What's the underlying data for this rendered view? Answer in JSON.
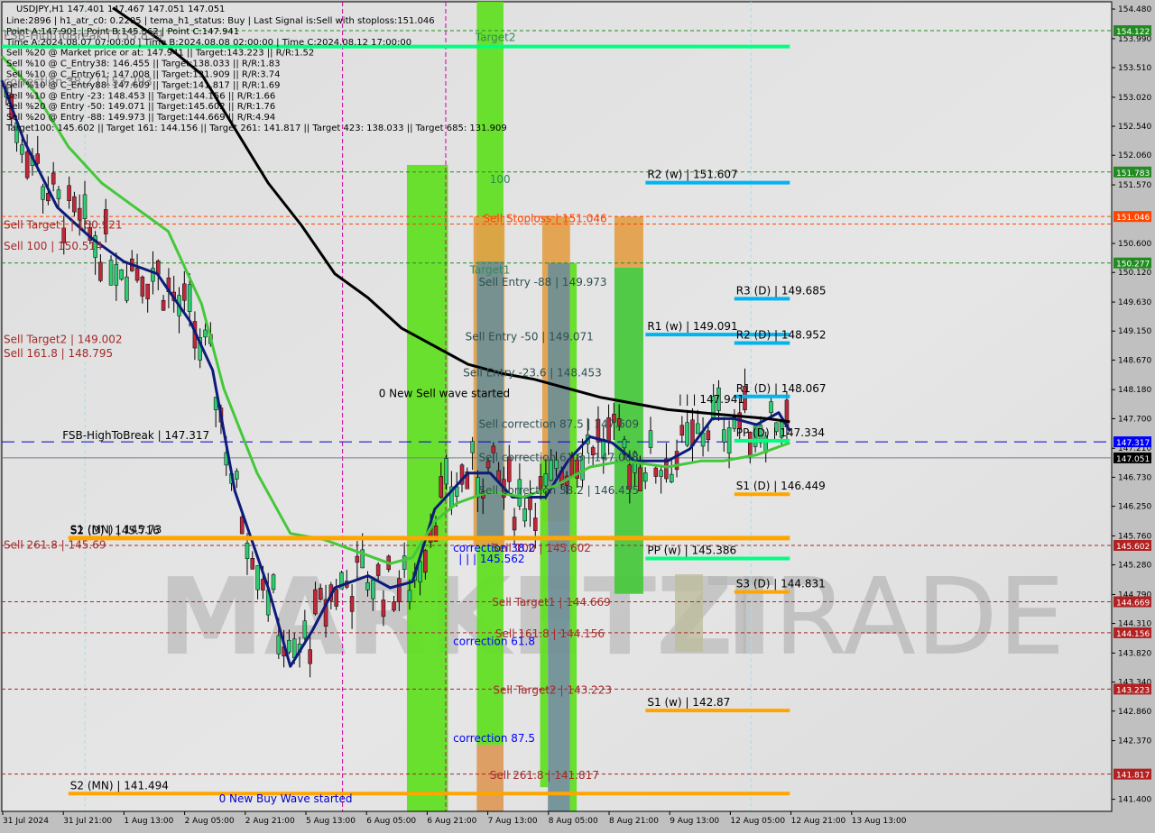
{
  "window": {
    "symbol_line": "USDJPY,H1  147.401 147.467 147.051 147.051"
  },
  "info_lines": [
    "Line:2896 | h1_atr_c0: 0.2205 | tema_h1_status: Buy | Last Signal is:Sell with stoploss:151.046",
    "Point A:147.901 | Point B:145.562 | Point C:147.941",
    "Time A:2024.08.07 07:00:00 | Time B:2024.08.08 02:00:00 | Time C:2024.08.12 17:00:00",
    "Sell %20 @ Market price or at: 147.941 || Target:143.223 || R/R:1.52",
    "Sell %10 @ C_Entry38: 146.455 || Target:138.033 || R/R:1.83",
    "Sell %10 @ C_Entry61: 147.008 || Target:131.909 || R/R:3.74",
    "Sell %10 @ C_Entry88: 147.609 || Target:141.817 || R/R:1.69",
    "Sell %10 @ Entry -23: 148.453 || Target:144.156 || R/R:1.66",
    "Sell %20 @ Entry -50: 149.071 || Target:145.602 || R/R:1.76",
    "Sell %20 @ Entry -88: 149.973 || Target:144.669 || R/R:4.94",
    "Target100: 145.602 || Target 161: 144.156 || Target 261: 141.817 || Target 423: 138.033 || Target 685: 131.909"
  ],
  "overlay_ghost_labels": [
    "FSB-HighToBreak | 153.839",
    "correction 38.2 | 153.293"
  ],
  "watermark": {
    "left": "MARKETZI",
    "right": "TRADE"
  },
  "colors": {
    "background": "#dcdcdc",
    "bull_candle": "#2ecc71",
    "bear_candle": "#c0283a",
    "ma_fast": "#0d1b7a",
    "ma_mid": "#44c83a",
    "ma_slow": "#000000",
    "green_zone": "#5ee01e",
    "orange_zone": "#e3a048",
    "grey_zone": "#6e8f96",
    "pivot_blue": "#00b4f0",
    "pivot_orange": "#ffa500",
    "pivot_green": "#00ff80",
    "sell_label": "#a52a2a",
    "stoploss_label": "#ff4500",
    "fsb_line": "#0000cc",
    "price_line": "#708090"
  },
  "chart_data": {
    "type": "candlestick",
    "title": "USDJPY,H1",
    "ohlc_last": {
      "open": 147.401,
      "high": 147.467,
      "low": 147.051,
      "close": 147.051
    },
    "ylim": [
      141.2,
      154.6
    ],
    "y_ticks": [
      "154.480",
      "153.990",
      "153.510",
      "153.020",
      "152.540",
      "152.060",
      "151.570",
      "150.600",
      "150.120",
      "149.630",
      "149.150",
      "148.670",
      "148.180",
      "147.700",
      "147.210",
      "146.730",
      "146.250",
      "145.760",
      "145.280",
      "144.790",
      "144.310",
      "143.820",
      "143.340",
      "142.860",
      "142.370",
      "141.400"
    ],
    "x_ticks": [
      "31 Jul 2024",
      "31 Jul 21:00",
      "1 Aug 13:00",
      "2 Aug 05:00",
      "2 Aug 21:00",
      "5 Aug 13:00",
      "6 Aug 05:00",
      "6 Aug 21:00",
      "7 Aug 13:00",
      "8 Aug 05:00",
      "8 Aug 21:00",
      "9 Aug 13:00",
      "12 Aug 05:00",
      "12 Aug 21:00",
      "13 Aug 13:00"
    ],
    "price_badges": [
      {
        "value": "154.122",
        "color": "#228b22"
      },
      {
        "value": "151.783",
        "color": "#228b22"
      },
      {
        "value": "151.046",
        "color": "#ff4500"
      },
      {
        "value": "150.277",
        "color": "#228b22"
      },
      {
        "value": "147.317",
        "color": "#0000ff"
      },
      {
        "value": "147.051",
        "color": "#000000"
      },
      {
        "value": "145.602",
        "color": "#b22222"
      },
      {
        "value": "144.669",
        "color": "#b22222"
      },
      {
        "value": "144.156",
        "color": "#b22222"
      },
      {
        "value": "143.223",
        "color": "#b22222"
      },
      {
        "value": "141.817",
        "color": "#b22222"
      }
    ],
    "hlines": [
      {
        "price": 154.122,
        "style": "dash",
        "color": "#228b22"
      },
      {
        "price": 151.783,
        "style": "dash",
        "color": "#228b22"
      },
      {
        "price": 151.046,
        "style": "dash",
        "color": "#ff4500"
      },
      {
        "price": 150.277,
        "style": "dash",
        "color": "#228b22"
      },
      {
        "price": 150.921,
        "style": "dash",
        "color": "#ff4500"
      },
      {
        "price": 147.317,
        "style": "longdash",
        "color": "#0000cc"
      },
      {
        "price": 147.051,
        "style": "solid",
        "color": "#708090"
      },
      {
        "price": 145.602,
        "style": "dash",
        "color": "#a52a2a"
      },
      {
        "price": 144.669,
        "style": "dash",
        "color": "#a52a2a"
      },
      {
        "price": 144.156,
        "style": "dash",
        "color": "#a52a2a"
      },
      {
        "price": 143.223,
        "style": "dash",
        "color": "#a52a2a"
      },
      {
        "price": 141.817,
        "style": "dash",
        "color": "#a52a2a"
      }
    ],
    "pivot_segments": [
      {
        "label": "R2 (w) | 151.607",
        "price": 151.607,
        "color": "#00b4f0",
        "x0": 0.58,
        "x1": 0.71
      },
      {
        "label": "R3 (D) | 149.685",
        "price": 149.685,
        "color": "#00b4f0",
        "x0": 0.66,
        "x1": 0.71
      },
      {
        "label": "R1 (w) | 149.091",
        "price": 149.091,
        "color": "#00b4f0",
        "x0": 0.58,
        "x1": 0.71
      },
      {
        "label": "R2 (D) | 148.952",
        "price": 148.952,
        "color": "#00b4f0",
        "x0": 0.66,
        "x1": 0.71
      },
      {
        "label": "R1 (D) | 148.067",
        "price": 148.067,
        "color": "#00b4f0",
        "x0": 0.66,
        "x1": 0.71
      },
      {
        "label": "PP (D) | 147.334",
        "price": 147.334,
        "color": "#00ff80",
        "x0": 0.66,
        "x1": 0.71
      },
      {
        "label": "S1 (D) | 146.449",
        "price": 146.449,
        "color": "#ffa500",
        "x0": 0.66,
        "x1": 0.71
      },
      {
        "label": "S2 (D) | 145.716",
        "price": 145.716,
        "color": "#ffa500",
        "x0": 0.06,
        "x1": 0.71
      },
      {
        "label": "PP (w) | 145.386",
        "price": 145.386,
        "color": "#00ff80",
        "x0": 0.58,
        "x1": 0.71
      },
      {
        "label": "S3 (D) | 144.831",
        "price": 144.831,
        "color": "#ffa500",
        "x0": 0.66,
        "x1": 0.71
      },
      {
        "label": "S1 (w) | 142.87",
        "price": 142.87,
        "color": "#ffa500",
        "x0": 0.58,
        "x1": 0.71
      },
      {
        "label": "S1 (MN) | 145.73",
        "price": 145.73,
        "color": "#ffa500",
        "x0": 0.06,
        "x1": 0.71
      },
      {
        "label": "S2 (MN) | 141.494",
        "price": 141.494,
        "color": "#ffa500",
        "x0": 0.06,
        "x1": 0.71
      },
      {
        "label": "",
        "price": 153.86,
        "color": "#00ff80",
        "x0": 0.0,
        "x1": 0.71
      }
    ],
    "text_labels": [
      {
        "text": "Target2",
        "price": 153.95,
        "x": 0.425,
        "color": "#2e8b57"
      },
      {
        "text": "100",
        "price": 151.6,
        "x": 0.438,
        "color": "#2e8b57"
      },
      {
        "text": "Sell Stoploss | 151.046",
        "price": 150.95,
        "x": 0.432,
        "color": "#ff4500"
      },
      {
        "text": "Target1",
        "price": 150.1,
        "x": 0.42,
        "color": "#2e8b57"
      },
      {
        "text": "Sell Entry -88 | 149.973",
        "price": 149.9,
        "x": 0.428,
        "color": "#2f4f4f"
      },
      {
        "text": "Sell Entry -50 | 149.071",
        "price": 149.0,
        "x": 0.416,
        "color": "#2f4f4f"
      },
      {
        "text": "Sell Entry -23.6 | 148.453",
        "price": 148.4,
        "x": 0.414,
        "color": "#2f4f4f"
      },
      {
        "text": "0 New Sell wave started",
        "price": 148.06,
        "x": 0.338,
        "color": "#000000"
      },
      {
        "text": "Sell correction 87.5 | 147.609",
        "price": 147.55,
        "x": 0.428,
        "color": "#2f4f4f"
      },
      {
        "text": "Sell correction 61.8 | 147.008",
        "price": 147.0,
        "x": 0.428,
        "color": "#2f4f4f"
      },
      {
        "text": "Sell correction 38.2 | 146.455",
        "price": 146.45,
        "x": 0.428,
        "color": "#2f4f4f"
      },
      {
        "text": "Sell 100 | 145.602",
        "price": 145.5,
        "x": 0.44,
        "color": "#a52a2a"
      },
      {
        "text": "correction 38.2",
        "price": 145.5,
        "x": 0.405,
        "color": "#0000ff"
      },
      {
        "text": "| | | 145.562",
        "price": 145.32,
        "x": 0.41,
        "color": "#0000ff"
      },
      {
        "text": "Sell Target1 | 144.669",
        "price": 144.6,
        "x": 0.44,
        "color": "#a52a2a"
      },
      {
        "text": "Sell 161.8 | 144.156",
        "price": 144.08,
        "x": 0.443,
        "color": "#a52a2a"
      },
      {
        "text": "correction 61.8",
        "price": 143.95,
        "x": 0.405,
        "color": "#0000ff"
      },
      {
        "text": "Sell Target2 | 143.223",
        "price": 143.15,
        "x": 0.441,
        "color": "#a52a2a"
      },
      {
        "text": "correction 87.5",
        "price": 142.35,
        "x": 0.405,
        "color": "#0000ff"
      },
      {
        "text": "Sell  261.8 | 141.817",
        "price": 141.74,
        "x": 0.438,
        "color": "#a52a2a"
      },
      {
        "text": "0 New Buy Wave started",
        "price": 141.35,
        "x": 0.194,
        "color": "#0000cc"
      },
      {
        "text": "| | | 147.941",
        "price": 147.96,
        "x": 0.608,
        "color": "#000000"
      },
      {
        "text": "Sell Target1 | 150.921",
        "price": 150.85,
        "x": 0.0,
        "color": "#a52a2a"
      },
      {
        "text": "Sell 100 | 150.514",
        "price": 150.5,
        "x": 0.0,
        "color": "#a52a2a"
      },
      {
        "text": "Sell Target2 | 149.002",
        "price": 148.95,
        "x": 0.0,
        "color": "#a52a2a"
      },
      {
        "text": "Sell 161.8 | 148.795",
        "price": 148.72,
        "x": 0.0,
        "color": "#a52a2a"
      },
      {
        "text": "FSB-HighToBreak | 147.317",
        "price": 147.36,
        "x": 0.053,
        "color": "#000000"
      },
      {
        "text": "Sell 261.8 | 145.69",
        "price": 145.55,
        "x": 0.0,
        "color": "#a52a2a"
      }
    ],
    "zones": [
      {
        "x0": 0.365,
        "x1": 0.402,
        "top": 151.9,
        "bottom": 141.2,
        "color": "#5ee01e"
      },
      {
        "x0": 0.428,
        "x1": 0.452,
        "top": 154.6,
        "bottom": 141.2,
        "color": "#5ee01e"
      },
      {
        "x0": 0.425,
        "x1": 0.453,
        "top": 151.046,
        "bottom": 145.6,
        "color": "#e3a048"
      },
      {
        "x0": 0.428,
        "x1": 0.452,
        "top": 150.3,
        "bottom": 145.7,
        "color": "#6e8f96"
      },
      {
        "x0": 0.428,
        "x1": 0.452,
        "top": 142.3,
        "bottom": 141.2,
        "color": "#e8996a"
      },
      {
        "x0": 0.487,
        "x1": 0.512,
        "top": 151.046,
        "bottom": 146.0,
        "color": "#e3a048"
      },
      {
        "x0": 0.492,
        "x1": 0.512,
        "top": 150.277,
        "bottom": 141.2,
        "color": "#6e8f96"
      },
      {
        "x0": 0.512,
        "x1": 0.518,
        "top": 150.277,
        "bottom": 141.2,
        "color": "#5ee01e"
      },
      {
        "x0": 0.552,
        "x1": 0.578,
        "top": 151.046,
        "bottom": 150.2,
        "color": "#e3a048"
      },
      {
        "x0": 0.552,
        "x1": 0.578,
        "top": 150.2,
        "bottom": 144.8,
        "color": "#44c83a"
      },
      {
        "x0": 0.485,
        "x1": 0.492,
        "top": 147.0,
        "bottom": 141.6,
        "color": "#5ee01e"
      }
    ],
    "series": [
      {
        "name": "TEMA fast",
        "color": "#0d1b7a",
        "points": [
          [
            0.0,
            153.3
          ],
          [
            0.02,
            152.3
          ],
          [
            0.05,
            151.2
          ],
          [
            0.08,
            150.7
          ],
          [
            0.11,
            150.3
          ],
          [
            0.14,
            150.1
          ],
          [
            0.17,
            149.3
          ],
          [
            0.19,
            148.5
          ],
          [
            0.21,
            146.5
          ],
          [
            0.24,
            144.9
          ],
          [
            0.26,
            143.6
          ],
          [
            0.28,
            144.2
          ],
          [
            0.3,
            144.9
          ],
          [
            0.33,
            145.1
          ],
          [
            0.35,
            144.9
          ],
          [
            0.37,
            145.0
          ],
          [
            0.39,
            146.2
          ],
          [
            0.42,
            146.8
          ],
          [
            0.44,
            146.8
          ],
          [
            0.46,
            146.4
          ],
          [
            0.49,
            146.4
          ],
          [
            0.51,
            147.0
          ],
          [
            0.53,
            147.4
          ],
          [
            0.55,
            147.3
          ],
          [
            0.57,
            147.0
          ],
          [
            0.6,
            147.0
          ],
          [
            0.62,
            147.2
          ],
          [
            0.64,
            147.7
          ],
          [
            0.66,
            147.7
          ],
          [
            0.68,
            147.6
          ],
          [
            0.7,
            147.8
          ],
          [
            0.71,
            147.5
          ]
        ]
      },
      {
        "name": "MA mid",
        "color": "#44c83a",
        "points": [
          [
            0.0,
            153.7
          ],
          [
            0.03,
            153.1
          ],
          [
            0.06,
            152.2
          ],
          [
            0.09,
            151.6
          ],
          [
            0.12,
            151.2
          ],
          [
            0.15,
            150.8
          ],
          [
            0.18,
            149.6
          ],
          [
            0.2,
            148.2
          ],
          [
            0.23,
            146.8
          ],
          [
            0.26,
            145.8
          ],
          [
            0.29,
            145.7
          ],
          [
            0.32,
            145.5
          ],
          [
            0.35,
            145.3
          ],
          [
            0.37,
            145.4
          ],
          [
            0.39,
            146.0
          ],
          [
            0.41,
            146.3
          ],
          [
            0.44,
            146.5
          ],
          [
            0.47,
            146.4
          ],
          [
            0.5,
            146.6
          ],
          [
            0.53,
            146.9
          ],
          [
            0.56,
            147.0
          ],
          [
            0.6,
            146.9
          ],
          [
            0.63,
            147.0
          ],
          [
            0.65,
            147.0
          ],
          [
            0.68,
            147.1
          ],
          [
            0.71,
            147.3
          ]
        ]
      },
      {
        "name": "MA slow",
        "color": "#000000",
        "points": [
          [
            0.1,
            154.5
          ],
          [
            0.14,
            154.0
          ],
          [
            0.18,
            153.4
          ],
          [
            0.21,
            152.5
          ],
          [
            0.24,
            151.6
          ],
          [
            0.27,
            150.9
          ],
          [
            0.3,
            150.1
          ],
          [
            0.33,
            149.7
          ],
          [
            0.36,
            149.2
          ],
          [
            0.39,
            148.9
          ],
          [
            0.42,
            148.6
          ],
          [
            0.45,
            148.45
          ],
          [
            0.48,
            148.35
          ],
          [
            0.51,
            148.2
          ],
          [
            0.54,
            148.05
          ],
          [
            0.57,
            147.95
          ],
          [
            0.6,
            147.85
          ],
          [
            0.63,
            147.8
          ],
          [
            0.66,
            147.75
          ],
          [
            0.69,
            147.7
          ],
          [
            0.71,
            147.65
          ]
        ]
      }
    ]
  }
}
